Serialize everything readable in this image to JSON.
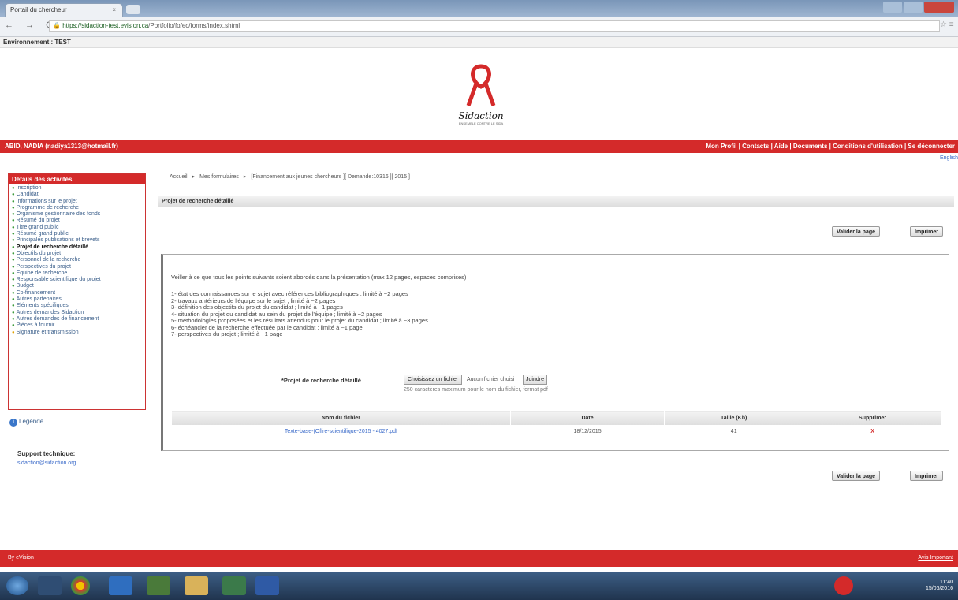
{
  "browser": {
    "tab_title": "Portail du chercheur",
    "tab_close": "×",
    "nav_glyphs": "← → C",
    "url_lock": "🔒",
    "url_host": "https://sidaction-test.evision.ca",
    "url_path": "/Portfolio/fo/ec/forms/index.shtml",
    "star_glyph": "☆ ≡"
  },
  "env_label": "Environnement : TEST",
  "logo": {
    "text": "Sidaction",
    "tagline": "ENSEMBLE CONTRE LE SIDA"
  },
  "header": {
    "user": "ABID, NADIA (nadiya1313@hotmail.fr)",
    "links": [
      "Mon Profil",
      "Contacts",
      "Aide",
      "Documents",
      "Conditions d'utilisation",
      "Se déconnecter"
    ],
    "sep": "|"
  },
  "language_link": "English",
  "sidebar": {
    "title": "Détails des activités",
    "items": [
      "Inscription",
      "Candidat",
      "Informations sur le projet",
      "Programme de recherche",
      "Organisme gestionnaire des fonds",
      "Résumé du projet",
      "Titre grand public",
      "Résumé grand public",
      "Principales publications et brevets",
      "Projet de recherche détaillé",
      "Objectifs du projet",
      "Personnel de la recherche",
      "Perspectives du projet",
      "Equipe de recherche",
      "Responsable scientifique du projet",
      "Budget",
      "Co-financement",
      "Autres partenaires",
      "Eléments spécifiques",
      "Autres demandes Sidaction",
      "Autres demandes de financement",
      "Pièces à fournir",
      "Signature et transmission"
    ],
    "active_index": 9
  },
  "legend": {
    "icon": "i",
    "label": "Légende"
  },
  "support": {
    "title": "Support technique:",
    "email": "sidaction@sidaction.org"
  },
  "breadcrumb": {
    "home": "Accueil",
    "forms": "Mes formulaires",
    "current": "[Financement aux jeunes chercheurs ][ Demande:10316 ][ 2015 ]",
    "sep": "▸"
  },
  "section_title": "Projet de recherche détaillé",
  "buttons": {
    "validate": "Valider la page",
    "print": "Imprimer"
  },
  "panel": {
    "intro": "Veiller à ce que tous les points suivants soient abordés dans la présentation (max 12 pages, espaces comprises)",
    "points": [
      "1- état des connaissances sur le sujet avec références bibliographiques ; limité à ~2 pages",
      "2- travaux antérieurs de l'équipe sur le sujet ; limité à ~2 pages",
      "3- définition des objectifs du projet du candidat ; limité à ~1 pages",
      "4- situation du projet du candidat au sein du projet de l'équipe ; limité à ~2 pages",
      "5- méthodologies proposées et les résultats attendus pour le projet du candidat ; limité à ~3 pages",
      "6- échéancier de la recherche effectuée par le candidat ; limité à ~1 page",
      "7- perspectives du projet ; limité à ~1 page"
    ],
    "file_label": "*Projet de recherche détaillé",
    "choose_button": "Choisissez un fichier",
    "no_file": "Aucun fichier choisi",
    "attach_button": "Joindre",
    "hint": "250 caractères maximum pour le nom du fichier, format pdf",
    "table": {
      "headers": [
        "Nom du fichier",
        "Date",
        "Taille (Kb)",
        "Supprimer"
      ],
      "rows": [
        [
          "Texte-base-(Offre-scientifique-2015 - 4027.pdf",
          "18/12/2015",
          "41",
          "X"
        ]
      ]
    }
  },
  "footer": {
    "left": "By eVision",
    "right": "Avis Important"
  },
  "tray": {
    "time": "11:40",
    "date": "15/06/2016"
  },
  "colors": {
    "brand_red": "#d42a2a",
    "link_blue": "#3a6ac9",
    "bullet_green": "#3a9a3a"
  }
}
